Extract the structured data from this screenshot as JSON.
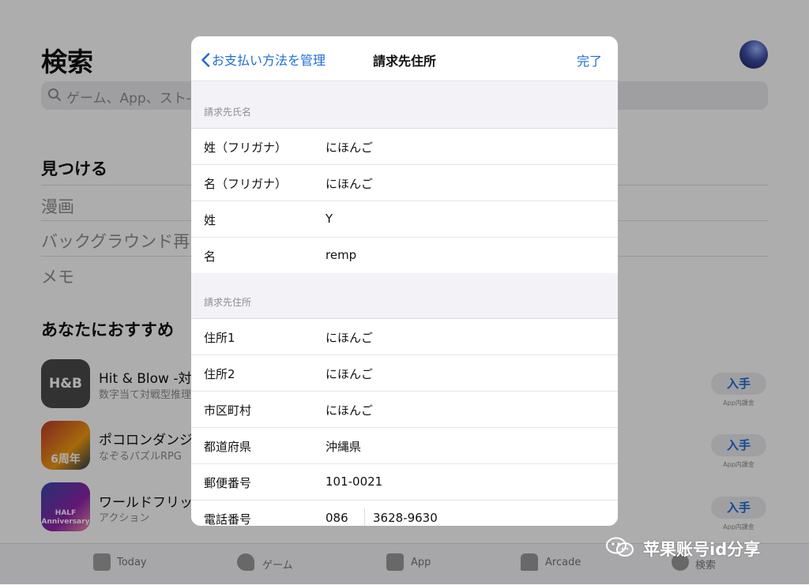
{
  "background": {
    "title": "検索",
    "search_placeholder": "ゲーム、App、スト-",
    "discover_title": "見つける",
    "discover_links": [
      "漫画",
      "バックグラウンド再",
      "メモ"
    ],
    "recommend_title": "あなたにおすすめ",
    "apps": [
      {
        "name": "Hit & Blow -対戦",
        "subtitle": "数字当て対戦型推理",
        "icon_text": "H&B",
        "get": "入手",
        "get_note": ""
      },
      {
        "name": "ポコロンダンジ",
        "subtitle": "なぞるパズルRPG",
        "icon_text": "6周年",
        "get": "入手",
        "get_note": "App内課金"
      },
      {
        "name": "ワールドフリッ",
        "subtitle": "アクション",
        "icon_text": "HALF Anniversary",
        "get": "入手",
        "get_note": "App内課金"
      }
    ],
    "first_get_note": "App内課金",
    "tabs": [
      "Today",
      "ゲーム",
      "App",
      "Arcade",
      "検索"
    ]
  },
  "modal": {
    "back_label": "お支払い方法を管理",
    "title": "請求先住所",
    "done_label": "完了",
    "name_section": {
      "header": "請求先氏名",
      "rows": [
        {
          "label": "姓（フリガナ）",
          "value": "にほんご"
        },
        {
          "label": "名（フリガナ）",
          "value": "にほんご"
        },
        {
          "label": "姓",
          "value": "Y"
        },
        {
          "label": "名",
          "value": "remp"
        }
      ]
    },
    "address_section": {
      "header": "請求先住所",
      "rows": [
        {
          "label": "住所1",
          "value": "にほんご"
        },
        {
          "label": "住所2",
          "value": "にほんご"
        },
        {
          "label": "市区町村",
          "value": "にほんご"
        },
        {
          "label": "都道府県",
          "value": "沖縄県"
        },
        {
          "label": "郵便番号",
          "value": "101-0021"
        }
      ],
      "phone": {
        "label": "電話番号",
        "area_code": "086",
        "number": "3628-9630"
      }
    }
  },
  "watermark": {
    "text": "苹果账号id分享"
  },
  "colors": {
    "accent": "#1e6cd7",
    "grouped_bg": "#f2f2f7",
    "secondary_text": "#8e8e93"
  }
}
